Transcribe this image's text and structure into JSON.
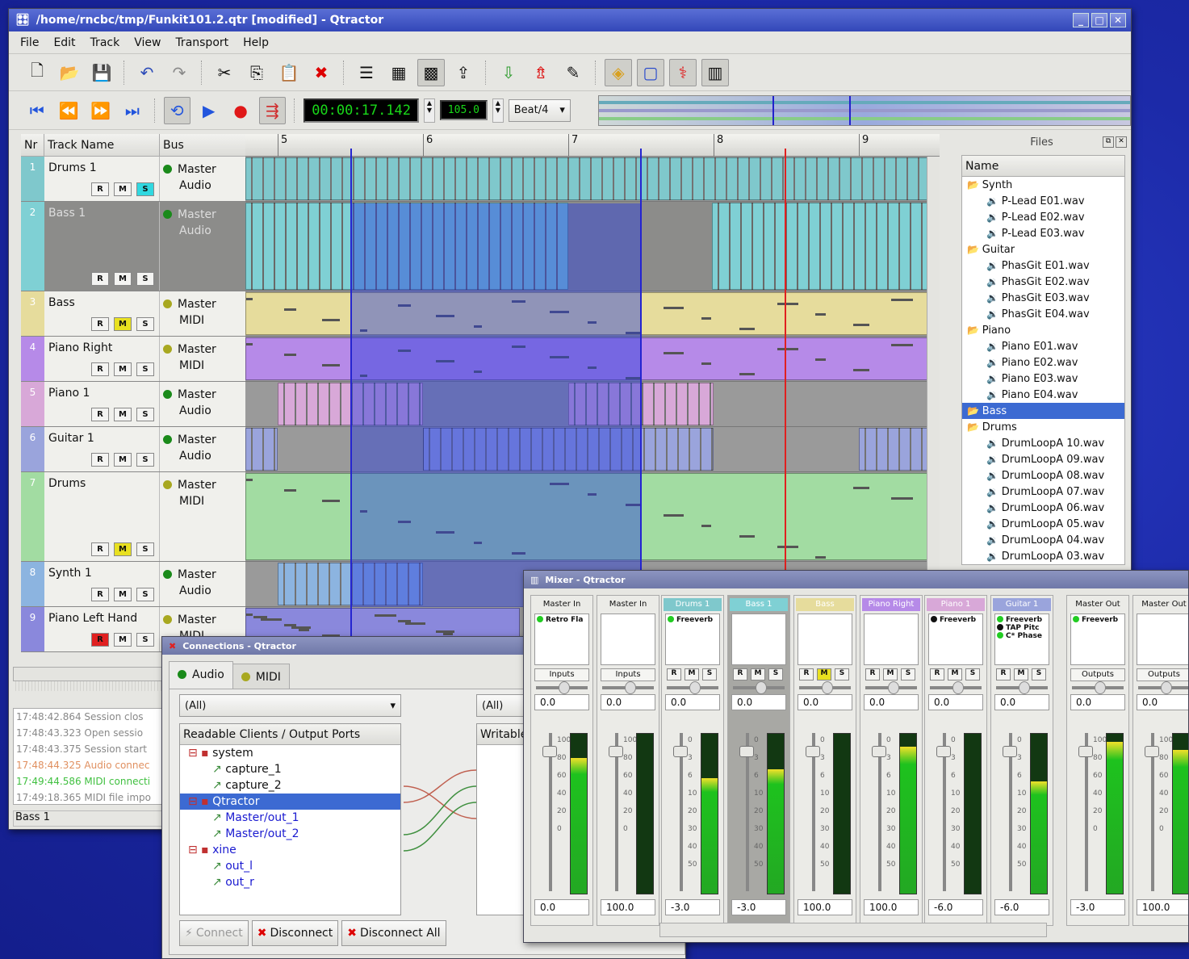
{
  "main": {
    "title": "/home/rncbc/tmp/Funkit101.2.qtr [modified] - Qtractor",
    "menu": [
      "File",
      "Edit",
      "Track",
      "View",
      "Transport",
      "Help"
    ],
    "time_display": "00:00:17.142",
    "tempo": "105.0",
    "snap": "Beat/4",
    "headers": {
      "nr": "Nr",
      "name": "Track Name",
      "bus": "Bus"
    },
    "ruler": [
      "5",
      "6",
      "7",
      "8",
      "9"
    ],
    "tracks": [
      {
        "nr": "1",
        "name": "Drums 1",
        "bus": "Master",
        "type": "Audio",
        "color": "#7fc8cc",
        "m_on": false,
        "s_on": true,
        "r_on": false
      },
      {
        "nr": "2",
        "name": "Bass 1",
        "bus": "Master",
        "type": "Audio",
        "color": "#7fd0d4",
        "m_on": false,
        "s_on": false,
        "r_on": false
      },
      {
        "nr": "3",
        "name": "Bass",
        "bus": "Master",
        "type": "MIDI",
        "color": "#e6dc9c",
        "m_on": true,
        "s_on": false,
        "r_on": false
      },
      {
        "nr": "4",
        "name": "Piano Right",
        "bus": "Master",
        "type": "MIDI",
        "color": "#b68ae8",
        "m_on": false,
        "s_on": false,
        "r_on": false
      },
      {
        "nr": "5",
        "name": "Piano 1",
        "bus": "Master",
        "type": "Audio",
        "color": "#d8a8d8",
        "m_on": false,
        "s_on": false,
        "r_on": false
      },
      {
        "nr": "6",
        "name": "Guitar 1",
        "bus": "Master",
        "type": "Audio",
        "color": "#9aa4dc",
        "m_on": false,
        "s_on": false,
        "r_on": false
      },
      {
        "nr": "7",
        "name": "Drums",
        "bus": "Master",
        "type": "MIDI",
        "color": "#a2dca2",
        "m_on": true,
        "s_on": false,
        "r_on": false
      },
      {
        "nr": "8",
        "name": "Synth 1",
        "bus": "Master",
        "type": "Audio",
        "color": "#8cb4e0",
        "m_on": false,
        "s_on": false,
        "r_on": false
      },
      {
        "nr": "9",
        "name": "Piano Left Hand",
        "bus": "Master",
        "type": "MIDI",
        "color": "#8a88dc",
        "m_on": false,
        "s_on": false,
        "r_on": true
      }
    ],
    "rms": {
      "r": "R",
      "m": "M",
      "s": "S"
    },
    "log": [
      {
        "text": "17:48:42.864 Session clos",
        "color": "#888"
      },
      {
        "text": "17:48:43.323 Open sessio",
        "color": "#888"
      },
      {
        "text": "17:48:43.375 Session start",
        "color": "#888"
      },
      {
        "text": "17:48:44.325 Audio connec",
        "color": "#e09060"
      },
      {
        "text": "17:49:44.586 MIDI connecti",
        "color": "#40c040"
      },
      {
        "text": "17:49:18.365 MIDI file impo",
        "color": "#888"
      }
    ],
    "status": "Bass 1"
  },
  "files": {
    "title": "Files",
    "header": "Name",
    "items": [
      {
        "label": "Synth",
        "group": true
      },
      {
        "label": "P-Lead E01.wav"
      },
      {
        "label": "P-Lead E02.wav"
      },
      {
        "label": "P-Lead E03.wav"
      },
      {
        "label": "Guitar",
        "group": true
      },
      {
        "label": "PhasGit E01.wav"
      },
      {
        "label": "PhasGit E02.wav"
      },
      {
        "label": "PhasGit E03.wav"
      },
      {
        "label": "PhasGit E04.wav"
      },
      {
        "label": "Piano",
        "group": true
      },
      {
        "label": "Piano E01.wav"
      },
      {
        "label": "Piano E02.wav"
      },
      {
        "label": "Piano E03.wav"
      },
      {
        "label": "Piano E04.wav"
      },
      {
        "label": "Bass",
        "group": true,
        "selected": true
      },
      {
        "label": "Drums",
        "group": true
      },
      {
        "label": "DrumLoopA 10.wav"
      },
      {
        "label": "DrumLoopA 09.wav"
      },
      {
        "label": "DrumLoopA 08.wav"
      },
      {
        "label": "DrumLoopA 07.wav"
      },
      {
        "label": "DrumLoopA 06.wav"
      },
      {
        "label": "DrumLoopA 05.wav"
      },
      {
        "label": "DrumLoopA 04.wav"
      },
      {
        "label": "DrumLoopA 03.wav"
      }
    ]
  },
  "connections": {
    "title": "Connections - Qtractor",
    "tabs": [
      "Audio",
      "MIDI"
    ],
    "filter_left": "(All)",
    "filter_right": "(All)",
    "left_header": "Readable Clients / Output Ports",
    "right_header": "Writable",
    "tree": [
      {
        "label": "system",
        "level": 0,
        "blue": false
      },
      {
        "label": "capture_1",
        "level": 1,
        "blue": false
      },
      {
        "label": "capture_2",
        "level": 1,
        "blue": false
      },
      {
        "label": "Qtractor",
        "level": 0,
        "blue": true,
        "selected": true
      },
      {
        "label": "Master/out_1",
        "level": 1,
        "blue": true
      },
      {
        "label": "Master/out_2",
        "level": 1,
        "blue": true
      },
      {
        "label": "xine",
        "level": 0,
        "blue": true
      },
      {
        "label": "out_l",
        "level": 1,
        "blue": true
      },
      {
        "label": "out_r",
        "level": 1,
        "blue": true
      }
    ],
    "buttons": [
      "Connect",
      "Disconnect",
      "Disconnect All"
    ]
  },
  "mixer": {
    "title": "Mixer - Qtractor",
    "strips": [
      {
        "name": "Master In",
        "color": "",
        "fx": [
          "Retro Fla"
        ],
        "io": "Inputs",
        "gain": "0.0",
        "pan": "0.0",
        "level": 0.85,
        "rms": false
      },
      {
        "name": "Master In",
        "color": "",
        "fx": [],
        "io": "Inputs",
        "gain": "0.0",
        "pan": "100.0",
        "level": 0.0,
        "rms": false
      },
      {
        "name": "Drums 1",
        "color": "#7fc8cc",
        "fx": [
          "Freeverb"
        ],
        "io": "",
        "gain": "0.0",
        "pan": "-3.0",
        "level": 0.72,
        "rms": true
      },
      {
        "name": "Bass 1",
        "color": "#7fd0d4",
        "fx": [],
        "io": "",
        "gain": "0.0",
        "pan": "-3.0",
        "level": 0.78,
        "rms": true
      },
      {
        "name": "Bass",
        "color": "#e6dc9c",
        "fx": [],
        "io": "",
        "gain": "0.0",
        "pan": "100.0",
        "level": 0.0,
        "rms": true
      },
      {
        "name": "Piano Right",
        "color": "#b68ae8",
        "fx": [],
        "io": "",
        "gain": "0.0",
        "pan": "100.0",
        "level": 0.92,
        "rms": true
      },
      {
        "name": "Piano 1",
        "color": "#d8a8d8",
        "fx": [
          "Freeverb"
        ],
        "io": "",
        "gain": "0.0",
        "pan": "-6.0",
        "level": 0.0,
        "rms": true
      },
      {
        "name": "Guitar 1",
        "color": "#9aa4dc",
        "fx": [
          "Freeverb",
          "TAP Pitc",
          "C* Phase"
        ],
        "io": "",
        "gain": "0.0",
        "pan": "-6.0",
        "level": 0.7,
        "rms": true
      },
      {
        "name": "Master Out",
        "color": "",
        "fx": [
          "Freeverb"
        ],
        "io": "Outputs",
        "gain": "0.0",
        "pan": "-3.0",
        "level": 0.95,
        "rms": false
      },
      {
        "name": "Master Out",
        "color": "",
        "fx": [],
        "io": "Outputs",
        "gain": "0.0",
        "pan": "100.0",
        "level": 0.9,
        "rms": false
      }
    ],
    "scale_db": [
      "0",
      "3",
      "6",
      "10",
      "20",
      "30",
      "40",
      "50"
    ],
    "scale_pct": [
      "100",
      "80",
      "60",
      "40",
      "20",
      "0"
    ]
  }
}
